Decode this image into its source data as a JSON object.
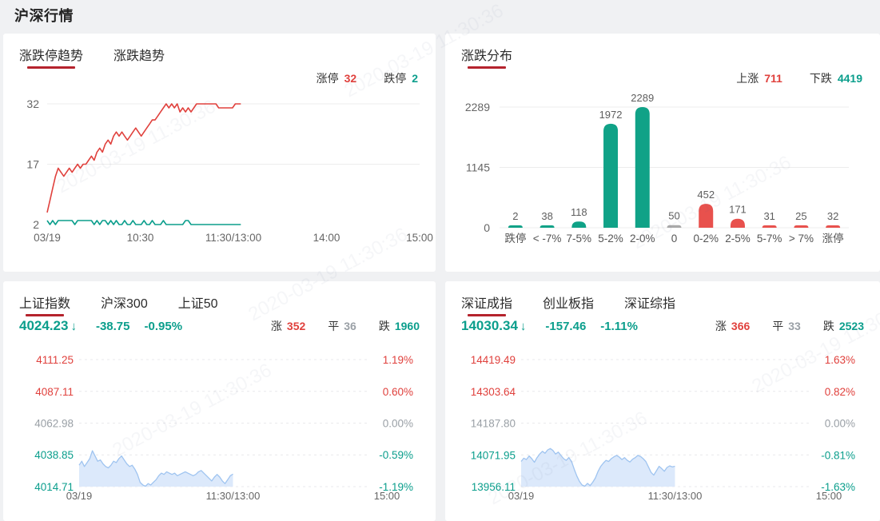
{
  "page": {
    "title": "沪深行情",
    "watermark": "2020-03-19 11:30:36"
  },
  "colors": {
    "up": "#e0413d",
    "down": "#0b9e8c",
    "flat": "#9aa0a6",
    "underline": "#b5232d",
    "bar_up": "#e8514d",
    "bar_down": "#10a287",
    "bar_flat": "#a9a9a9",
    "axis": "#666666",
    "grid": "#ececec",
    "area_line": "#9fc4f0",
    "area_fill": "#dce9fb",
    "page_bg": "#f0f1f3",
    "panel_bg": "#ffffff"
  },
  "limit_trend": {
    "tabs": [
      {
        "label": "涨跌停趋势",
        "active": true
      },
      {
        "label": "涨跌趋势",
        "active": false
      }
    ],
    "legend": [
      {
        "label": "涨停",
        "value": "32",
        "tone": "up"
      },
      {
        "label": "跌停",
        "value": "2",
        "tone": "down"
      }
    ],
    "chart_data": {
      "type": "line",
      "title": "涨跌停趋势",
      "x_ticks": [
        "03/19",
        "10:30",
        "11:30/13:00",
        "14:00",
        "15:00"
      ],
      "y_ticks": [
        32,
        17,
        2
      ],
      "ylim": [
        2,
        32
      ],
      "x_end_frac": 0.52,
      "series": [
        {
          "name": "涨停",
          "tone": "up",
          "values": [
            5,
            8,
            11,
            14,
            16,
            15,
            14,
            15,
            16,
            15,
            16,
            17,
            16,
            17,
            17,
            18,
            19,
            18,
            20,
            21,
            20,
            22,
            23,
            22,
            24,
            25,
            24,
            25,
            24,
            23,
            24,
            25,
            26,
            25,
            24,
            25,
            26,
            27,
            28,
            28,
            29,
            30,
            31,
            32,
            31,
            32,
            31,
            32,
            30,
            31,
            30,
            31,
            30,
            31,
            32,
            32,
            32,
            32,
            32,
            32,
            32,
            32,
            31,
            31,
            31,
            31,
            31,
            31,
            32,
            32,
            32
          ]
        },
        {
          "name": "跌停",
          "tone": "down",
          "values": [
            3,
            2,
            3,
            2,
            3,
            3,
            3,
            3,
            3,
            3,
            2,
            3,
            3,
            3,
            3,
            3,
            3,
            2,
            3,
            2,
            3,
            3,
            2,
            3,
            2,
            3,
            2,
            2,
            3,
            2,
            2,
            3,
            2,
            2,
            2,
            3,
            2,
            2,
            3,
            2,
            2,
            2,
            3,
            2,
            2,
            2,
            2,
            2,
            2,
            2,
            3,
            3,
            2,
            2,
            2,
            2,
            2,
            2,
            2,
            2,
            2,
            2,
            2,
            2,
            2,
            2,
            2,
            2,
            2,
            2,
            2
          ]
        }
      ]
    }
  },
  "distribution": {
    "title": "涨跌分布",
    "legend": [
      {
        "label": "上涨",
        "value": "711",
        "tone": "up"
      },
      {
        "label": "下跌",
        "value": "4419",
        "tone": "down"
      }
    ],
    "chart_data": {
      "type": "bar",
      "title": "涨跌分布",
      "categories": [
        "跌停",
        "< -7%",
        "7-5%",
        "5-2%",
        "2-0%",
        "0",
        "0-2%",
        "2-5%",
        "5-7%",
        "> 7%",
        "涨停"
      ],
      "values": [
        2,
        38,
        118,
        1972,
        2289,
        50,
        452,
        171,
        31,
        25,
        32
      ],
      "tones": [
        "down",
        "down",
        "down",
        "down",
        "down",
        "flat",
        "up",
        "up",
        "up",
        "up",
        "up"
      ],
      "y_ticks": [
        2289,
        1145,
        0
      ],
      "ylim": [
        0,
        2289
      ]
    }
  },
  "sh_index": {
    "tabs": [
      {
        "label": "上证指数",
        "active": true
      },
      {
        "label": "沪深300",
        "active": false
      },
      {
        "label": "上证50",
        "active": false
      }
    ],
    "quote": {
      "price": "4024.23",
      "change": "-38.75",
      "pct": "-0.95%",
      "direction": "down"
    },
    "stats": [
      {
        "label": "涨",
        "value": "352",
        "tone": "up"
      },
      {
        "label": "平",
        "value": "36",
        "tone": "flat"
      },
      {
        "label": "跌",
        "value": "1960",
        "tone": "down"
      }
    ],
    "chart_data": {
      "type": "area",
      "title": "上证指数",
      "x_ticks": [
        "03/19",
        "11:30/13:00",
        "15:00"
      ],
      "levels": [
        {
          "price": "4111.25",
          "pct": "1.19%",
          "tone": "up"
        },
        {
          "price": "4087.11",
          "pct": "0.60%",
          "tone": "up"
        },
        {
          "price": "4062.98",
          "pct": "0.00%",
          "tone": "flat"
        },
        {
          "price": "4038.85",
          "pct": "-0.59%",
          "tone": "down"
        },
        {
          "price": "4014.71",
          "pct": "-1.19%",
          "tone": "down"
        }
      ],
      "x_end_frac": 0.5,
      "values": [
        4031,
        4034,
        4030,
        4033,
        4036,
        4042,
        4038,
        4034,
        4035,
        4032,
        4030,
        4029,
        4031,
        4034,
        4033,
        4036,
        4038,
        4035,
        4032,
        4030,
        4031,
        4028,
        4024,
        4018,
        4016,
        4015,
        4017,
        4016,
        4018,
        4020,
        4023,
        4025,
        4024,
        4026,
        4025,
        4024,
        4025,
        4023,
        4024,
        4025,
        4026,
        4025,
        4024,
        4023,
        4024,
        4026,
        4027,
        4025,
        4023,
        4021,
        4019,
        4022,
        4024,
        4022,
        4019,
        4017,
        4020,
        4023,
        4024.23
      ]
    }
  },
  "sz_index": {
    "tabs": [
      {
        "label": "深证成指",
        "active": true
      },
      {
        "label": "创业板指",
        "active": false
      },
      {
        "label": "深证综指",
        "active": false
      }
    ],
    "quote": {
      "price": "14030.34",
      "change": "-157.46",
      "pct": "-1.11%",
      "direction": "down"
    },
    "stats": [
      {
        "label": "涨",
        "value": "366",
        "tone": "up"
      },
      {
        "label": "平",
        "value": "33",
        "tone": "flat"
      },
      {
        "label": "跌",
        "value": "2523",
        "tone": "down"
      }
    ],
    "chart_data": {
      "type": "area",
      "title": "深证成指",
      "x_ticks": [
        "03/19",
        "11:30/13:00",
        "15:00"
      ],
      "levels": [
        {
          "price": "14419.49",
          "pct": "1.63%",
          "tone": "up"
        },
        {
          "price": "14303.64",
          "pct": "0.82%",
          "tone": "up"
        },
        {
          "price": "14187.80",
          "pct": "0.00%",
          "tone": "flat"
        },
        {
          "price": "14071.95",
          "pct": "-0.81%",
          "tone": "down"
        },
        {
          "price": "13956.11",
          "pct": "-1.63%",
          "tone": "down"
        }
      ],
      "x_end_frac": 0.5,
      "values": [
        14048,
        14060,
        14055,
        14068,
        14058,
        14045,
        14062,
        14075,
        14085,
        14078,
        14090,
        14095,
        14088,
        14075,
        14082,
        14070,
        14058,
        14052,
        14062,
        14048,
        14020,
        13995,
        13975,
        13962,
        13958,
        13968,
        13960,
        13972,
        13988,
        14012,
        14030,
        14042,
        14052,
        14048,
        14058,
        14065,
        14070,
        14064,
        14055,
        14062,
        14052,
        14046,
        14056,
        14062,
        14070,
        14066,
        14058,
        14048,
        14028,
        14008,
        13998,
        14014,
        14030,
        14022,
        14012,
        14026,
        14032,
        14028,
        14030.34
      ]
    }
  }
}
